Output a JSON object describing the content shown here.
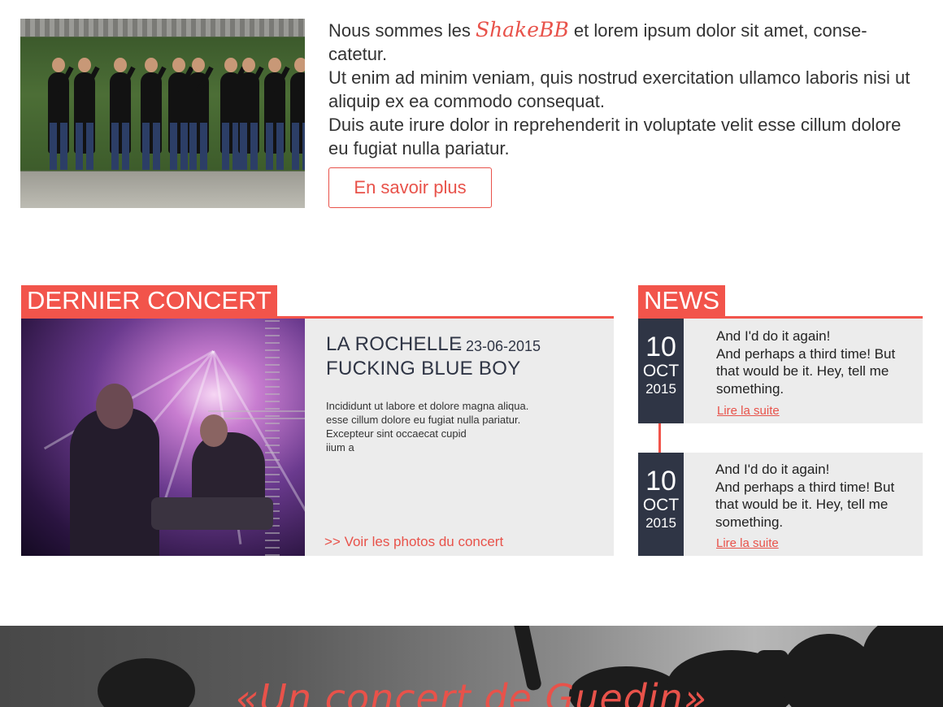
{
  "intro": {
    "text_before": "Nous sommes les ",
    "brand": "ShakeBB",
    "text_after": " et lorem ipsum dolor sit amet, conse-catetur.",
    "line2": "Ut enim ad minim veniam, quis nostrud exercitation ullamco laboris nisi ut aliquip ex ea commodo consequat.",
    "line3": "Duis aute irure dolor in reprehenderit in voluptate velit esse cillum dolore eu fugiat nulla pariatur.",
    "button_label": "En savoir plus"
  },
  "concert": {
    "section_title": "DERNIER CONCERT",
    "city": "LA ROCHELLE",
    "date": "- 23-06-2015",
    "band": "FUCKING BLUE BOY",
    "desc_lines": [
      "Incididunt ut labore et dolore magna aliqua.",
      "esse cillum dolore eu fugiat nulla pariatur.",
      "Excepteur sint occaecat cupid",
      "iium a"
    ],
    "photos_link": ">> Voir les photos du concert"
  },
  "news": {
    "section_title": "NEWS",
    "items": [
      {
        "day": "10",
        "month": "OCT",
        "year": "2015",
        "lines": [
          "And I'd do it again!",
          "And perhaps a third time! But that would be it. Hey, tell me something."
        ],
        "link": "Lire la suite"
      },
      {
        "day": "10",
        "month": "OCT",
        "year": "2015",
        "lines": [
          "And I'd do it again!",
          "And perhaps a third time! But that would be it. Hey, tell me something."
        ],
        "link": "Lire la suite"
      }
    ]
  },
  "banner": {
    "quote": "«Un concert de Guedin»"
  },
  "colors": {
    "accent": "#f2544b",
    "dark": "#2f3545",
    "panel": "#ececec"
  }
}
